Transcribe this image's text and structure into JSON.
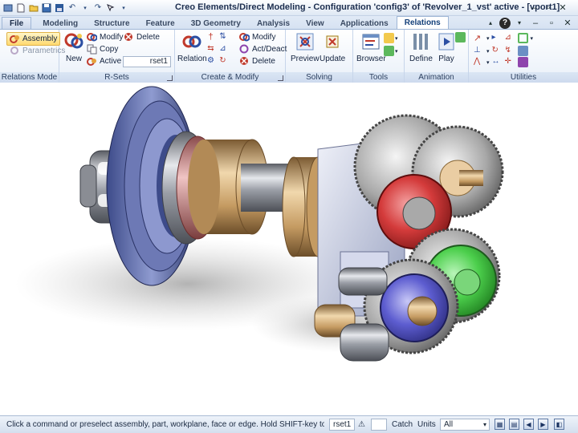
{
  "window": {
    "title": "Creo Elements/Direct Modeling - Configuration 'config3' of 'Revolver_1_vst' active - [vport1]"
  },
  "tabs": [
    "File",
    "Modeling",
    "Structure",
    "Feature",
    "3D Geometry",
    "Analysis",
    "View",
    "Applications",
    "Relations"
  ],
  "active_tab": "Relations",
  "ribbon": {
    "relations_mode": {
      "label": "Relations Mode",
      "assembly": "Assembly",
      "parametrics": "Parametrics"
    },
    "rsets": {
      "label": "R-Sets",
      "new": "New",
      "modify": "Modify",
      "delete": "Delete",
      "copy": "Copy",
      "active": "Active",
      "active_value": "rset1"
    },
    "create_modify": {
      "label": "Create & Modify",
      "relation": "Relation",
      "modify": "Modify",
      "act_deact": "Act/Deact",
      "delete": "Delete"
    },
    "solving": {
      "label": "Solving",
      "preview": "Preview",
      "update": "Update"
    },
    "tools": {
      "label": "Tools",
      "browser": "Browser"
    },
    "animation": {
      "label": "Animation",
      "define": "Define",
      "play": "Play"
    },
    "utilities": {
      "label": "Utilities"
    }
  },
  "status": {
    "prompt": "Click a command or preselect assembly, part, workplane, face or edge. Hold SHIFT-key to select multipl...",
    "rset": "rset1",
    "catch_label": "Catch",
    "units_label": "Units",
    "filter_value": "All"
  }
}
